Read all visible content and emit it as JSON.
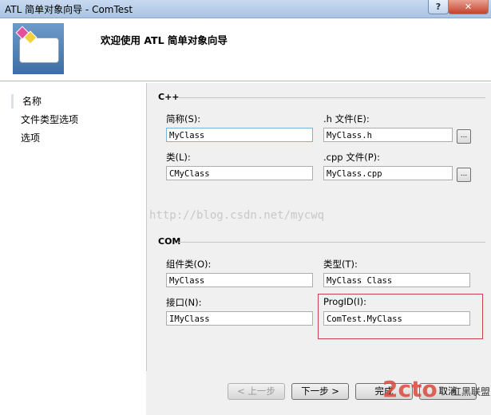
{
  "window": {
    "title": "ATL 简单对象向导 - ComTest",
    "help_label": "?",
    "close_label": "✕"
  },
  "header": {
    "title": "欢迎使用 ATL 简单对象向导",
    "icon": "wizard-icon"
  },
  "nav": {
    "items": [
      {
        "label": "名称",
        "selected": true
      },
      {
        "label": "文件类型选项",
        "selected": false
      },
      {
        "label": "选项",
        "selected": false
      }
    ]
  },
  "cpp_section": {
    "title": "C++",
    "short_name": {
      "label": "简称(S):",
      "value": "MyClass"
    },
    "h_file": {
      "label": ".h 文件(E):",
      "value": "MyClass.h",
      "browse_label": "..."
    },
    "class": {
      "label": "类(L):",
      "value": "CMyClass"
    },
    "cpp_file": {
      "label": ".cpp 文件(P):",
      "value": "MyClass.cpp",
      "browse_label": "..."
    }
  },
  "com_section": {
    "title": "COM",
    "coclass": {
      "label": "组件类(O):",
      "value": "MyClass"
    },
    "type": {
      "label": "类型(T):",
      "value": "MyClass Class"
    },
    "interface": {
      "label": "接口(N):",
      "value": "IMyClass"
    },
    "progid": {
      "label": "ProgID(I):",
      "value": "ComTest.MyClass"
    }
  },
  "watermark": "http://blog.csdn.net/mycwq",
  "buttons": {
    "back": "< 上一步",
    "next": "下一步 >",
    "finish": "完成",
    "cancel": "取消"
  },
  "logo_watermark": {
    "text": "2cto",
    "sub": "红黑联盟"
  },
  "colors": {
    "highlight_border": "#c9424f",
    "titlebar": "#b9cfe9"
  }
}
